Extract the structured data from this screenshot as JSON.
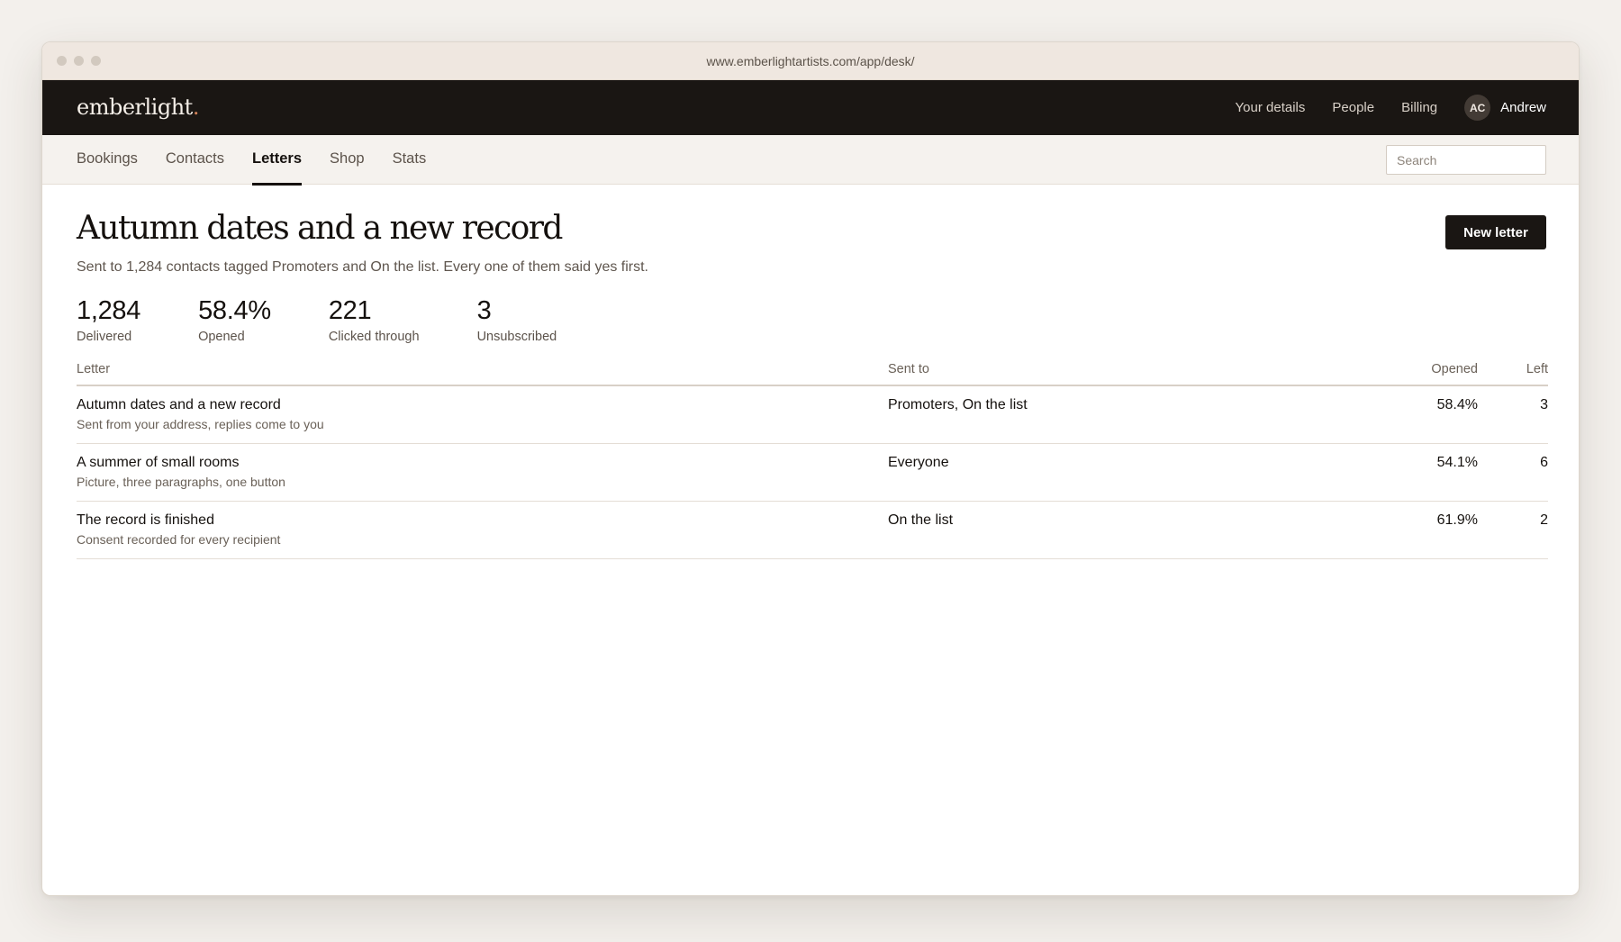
{
  "browser": {
    "url": "www.emberlightartists.com/app/desk/"
  },
  "topbar": {
    "logo": "emberlight",
    "logo_dot": ".",
    "nav": [
      "Your details",
      "People",
      "Billing"
    ],
    "user": {
      "initials": "AC",
      "name": "Andrew"
    }
  },
  "subnav": {
    "tabs": [
      {
        "label": "Bookings",
        "active": false
      },
      {
        "label": "Contacts",
        "active": false
      },
      {
        "label": "Letters",
        "active": true
      },
      {
        "label": "Shop",
        "active": false
      },
      {
        "label": "Stats",
        "active": false
      }
    ],
    "search_placeholder": "Search"
  },
  "main": {
    "title": "Autumn dates and a new record",
    "subtitle": "Sent to 1,284 contacts tagged Promoters and On the list. Every one of them said yes first.",
    "new_letter_label": "New letter",
    "stats": [
      {
        "value": "1,284",
        "label": "Delivered"
      },
      {
        "value": "58.4%",
        "label": "Opened"
      },
      {
        "value": "221",
        "label": "Clicked through"
      },
      {
        "value": "3",
        "label": "Unsubscribed"
      }
    ],
    "table": {
      "headers": {
        "letter": "Letter",
        "sent_to": "Sent to",
        "opened": "Opened",
        "left": "Left"
      },
      "rows": [
        {
          "title": "Autumn dates and a new record",
          "note": "Sent from your address, replies come to you",
          "sent_to": "Promoters, On the list",
          "opened": "58.4%",
          "left": "3"
        },
        {
          "title": "A summer of small rooms",
          "note": "Picture, three paragraphs, one button",
          "sent_to": "Everyone",
          "opened": "54.1%",
          "left": "6"
        },
        {
          "title": "The record is finished",
          "note": "Consent recorded for every recipient",
          "sent_to": "On the list",
          "opened": "61.9%",
          "left": "2"
        }
      ]
    }
  },
  "colors": {
    "topbar": "#1a1613",
    "accent": "#d6845a",
    "primary_button": "#1a1613",
    "page_background": "#f3f0ec"
  }
}
